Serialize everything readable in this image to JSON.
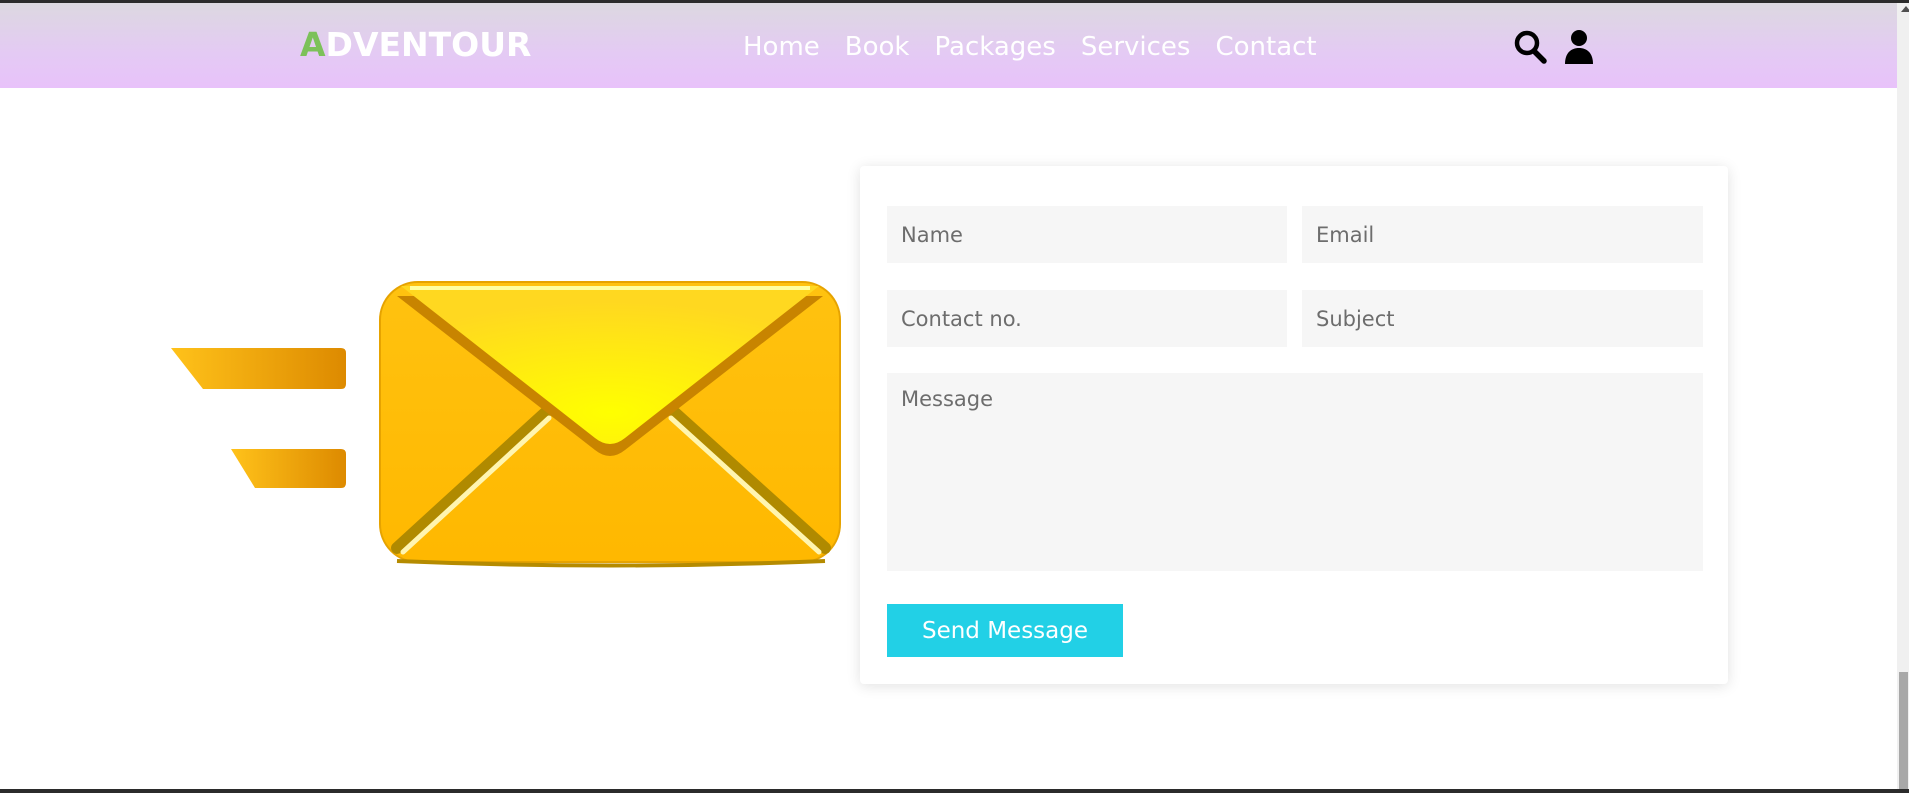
{
  "header": {
    "brand_first_letter": "A",
    "brand_rest": "DVENTOUR",
    "nav": [
      {
        "label": "Home"
      },
      {
        "label": "Book"
      },
      {
        "label": "Packages"
      },
      {
        "label": "Services"
      },
      {
        "label": "Contact"
      }
    ],
    "icons": {
      "search": "search-icon",
      "user": "user-icon"
    }
  },
  "hero": {
    "image": "envelope-icon"
  },
  "contact_form": {
    "name_placeholder": "Name",
    "email_placeholder": "Email",
    "contact_placeholder": "Contact no.",
    "subject_placeholder": "Subject",
    "message_placeholder": "Message",
    "submit_label": "Send Message"
  },
  "colors": {
    "brand_accent": "#7cc15a",
    "button": "#22d0e6",
    "header_gradient_end": "#e8c2fa",
    "envelope": "#ffc107"
  }
}
